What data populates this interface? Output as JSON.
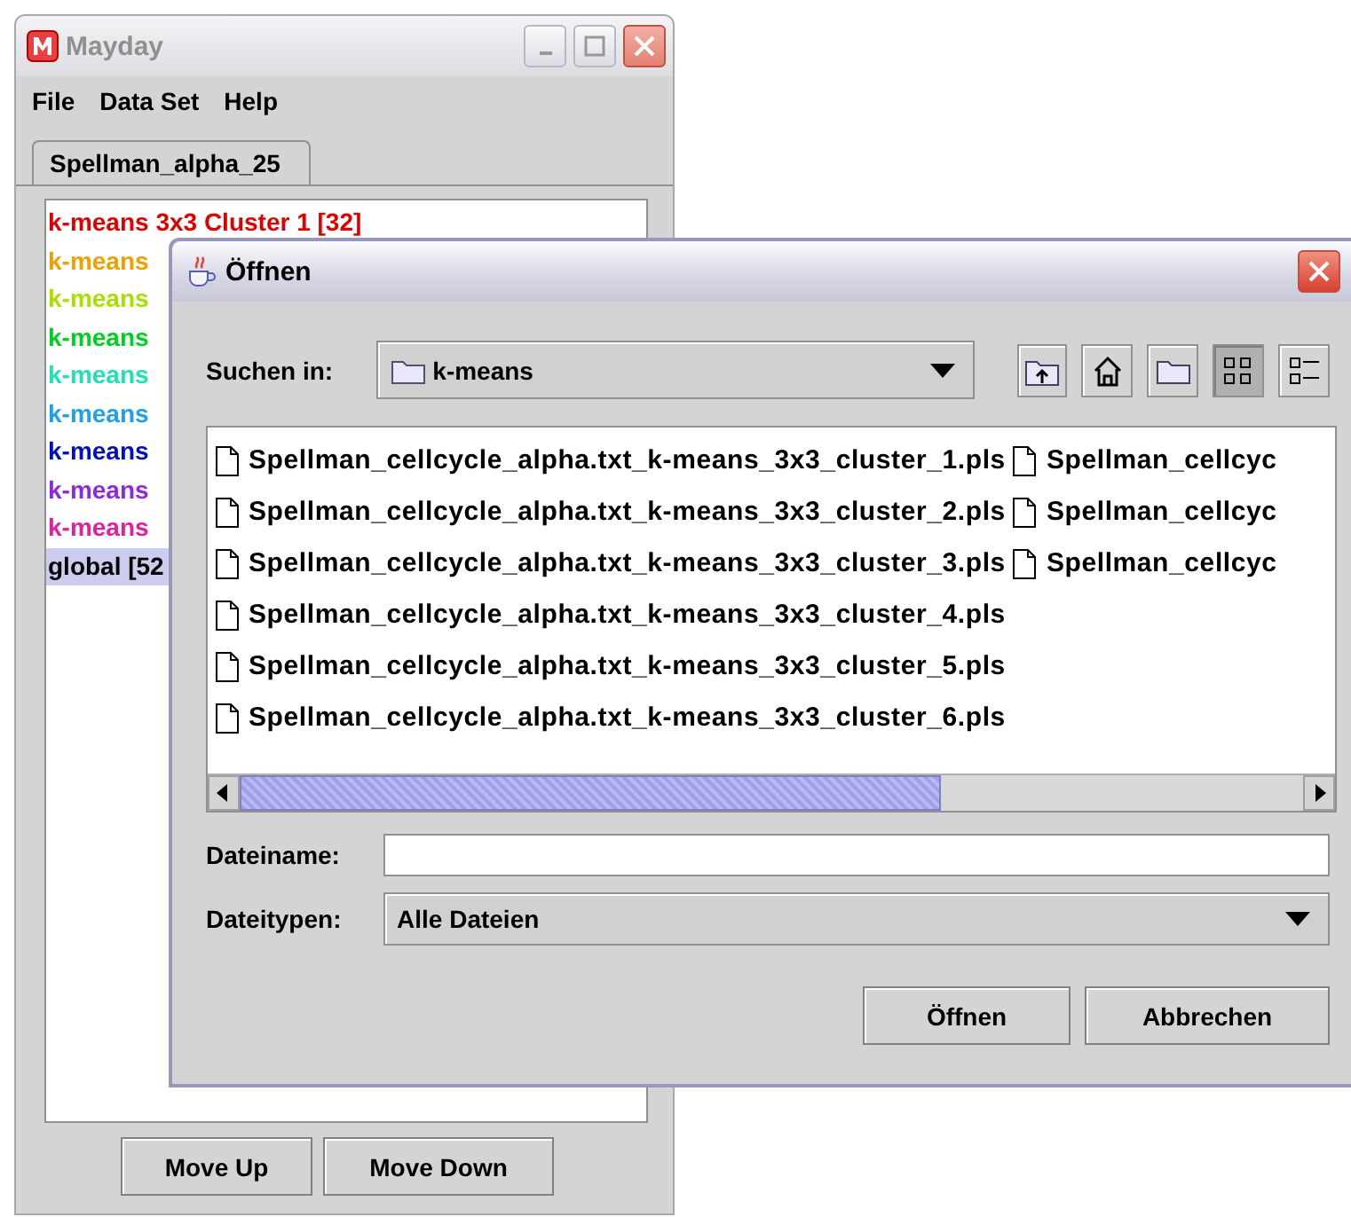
{
  "main_window": {
    "title": "Mayday",
    "menu": [
      "File",
      "Data Set",
      "Help"
    ],
    "tabs": [
      {
        "label": "Spellman_alpha_25",
        "selected": true
      }
    ],
    "clusters": [
      {
        "label": "k-means 3x3 Cluster 1 [32]",
        "color": "#e00000",
        "selected": false
      },
      {
        "label": "k-means",
        "color": "#f0a000",
        "selected": false
      },
      {
        "label": "k-means",
        "color": "#a8e000",
        "selected": false
      },
      {
        "label": "k-means",
        "color": "#00d020",
        "selected": false
      },
      {
        "label": "k-means",
        "color": "#20e0b8",
        "selected": false
      },
      {
        "label": "k-means",
        "color": "#20a0e8",
        "selected": false
      },
      {
        "label": "k-means",
        "color": "#0010c0",
        "selected": false
      },
      {
        "label": "k-means",
        "color": "#9028e0",
        "selected": false
      },
      {
        "label": "k-means",
        "color": "#e020a0",
        "selected": false
      },
      {
        "label": "global [52",
        "color": "#000000",
        "selected": true
      }
    ],
    "buttons": [
      "Move Up",
      "Move Down"
    ]
  },
  "dialog": {
    "title": "Öffnen",
    "look_in_label": "Suchen in:",
    "look_in_value": "k-means",
    "view_buttons": [
      {
        "kind": "list",
        "selected": true
      },
      {
        "kind": "details",
        "selected": false
      }
    ],
    "file_columns": [
      [
        "Spellman_cellcycle_alpha.txt_k-means_3x3_cluster_1.pls",
        "Spellman_cellcycle_alpha.txt_k-means_3x3_cluster_2.pls",
        "Spellman_cellcycle_alpha.txt_k-means_3x3_cluster_3.pls",
        "Spellman_cellcycle_alpha.txt_k-means_3x3_cluster_4.pls",
        "Spellman_cellcycle_alpha.txt_k-means_3x3_cluster_5.pls",
        "Spellman_cellcycle_alpha.txt_k-means_3x3_cluster_6.pls"
      ],
      [
        "Spellman_cellcyc",
        "Spellman_cellcyc",
        "Spellman_cellcyc"
      ]
    ],
    "filename_label": "Dateiname:",
    "filetype_label": "Dateitypen:",
    "filetype_value": "Alle Dateien",
    "buttons": [
      "Öffnen",
      "Abbrechen"
    ]
  }
}
